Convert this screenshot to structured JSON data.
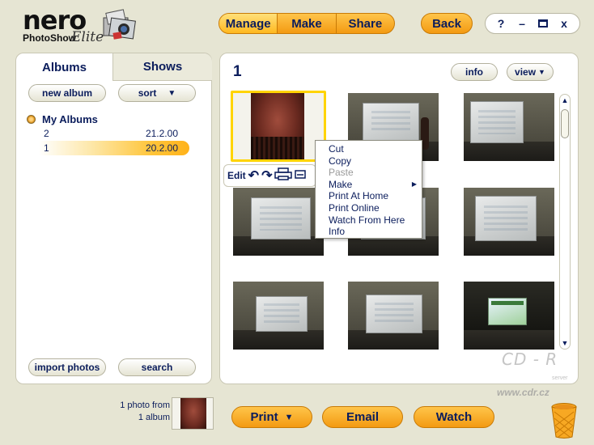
{
  "app": {
    "logo_brand": "nero",
    "logo_product": "PhotoShow",
    "logo_edition": "Elite"
  },
  "nav": {
    "tabs": [
      {
        "label": "Manage",
        "active": true
      },
      {
        "label": "Make",
        "active": false
      },
      {
        "label": "Share",
        "active": false
      }
    ],
    "back_label": "Back"
  },
  "window_controls": {
    "help": "?",
    "minimize": "–",
    "close": "x"
  },
  "sidebar": {
    "tabs": [
      {
        "label": "Albums",
        "active": true
      },
      {
        "label": "Shows",
        "active": false
      }
    ],
    "new_album_label": "new album",
    "sort_label": "sort",
    "tree_root": "My Albums",
    "albums": [
      {
        "name": "2",
        "date": "21.2.00",
        "selected": false
      },
      {
        "name": "1",
        "date": "20.2.00",
        "selected": true
      }
    ],
    "import_label": "import photos",
    "search_label": "search"
  },
  "main": {
    "photo_count": "1",
    "info_label": "info",
    "view_label": "view",
    "edit_label": "Edit"
  },
  "context_menu": {
    "items": [
      {
        "label": "Cut",
        "enabled": true,
        "submenu": false
      },
      {
        "label": "Copy",
        "enabled": true,
        "submenu": false
      },
      {
        "label": "Paste",
        "enabled": false,
        "submenu": false
      },
      {
        "label": "Make",
        "enabled": true,
        "submenu": true
      },
      {
        "label": "Print At Home",
        "enabled": true,
        "submenu": false
      },
      {
        "label": "Print Online",
        "enabled": true,
        "submenu": false
      },
      {
        "label": "Watch From Here",
        "enabled": true,
        "submenu": false
      },
      {
        "label": "Info",
        "enabled": true,
        "submenu": false
      }
    ]
  },
  "footer": {
    "selection_line1": "1 photo from",
    "selection_line2": "1 album",
    "print_label": "Print",
    "email_label": "Email",
    "watch_label": "Watch"
  },
  "watermark": {
    "logo": "CD - R",
    "sub": "server",
    "url": "www.cdr.cz"
  },
  "colors": {
    "accent_orange": "#f7a823",
    "selection_yellow": "#ffd400",
    "text_navy": "#0b1d5c",
    "background": "#e6e5d3"
  }
}
